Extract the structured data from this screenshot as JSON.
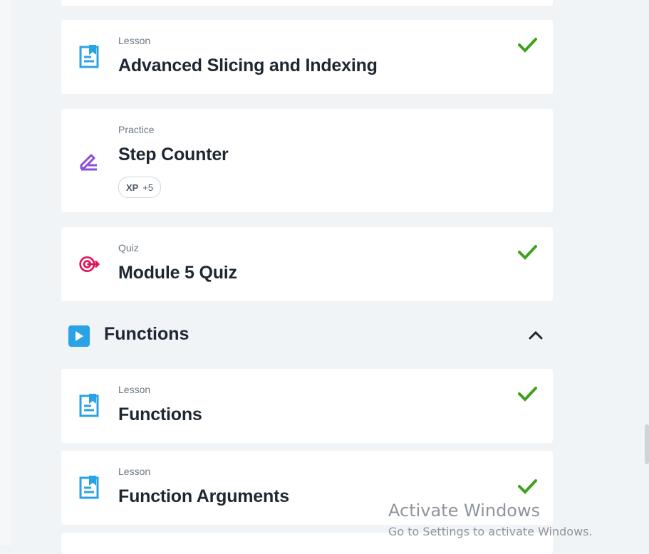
{
  "items": [
    {
      "kind": "Lesson",
      "title": "Advanced Slicing and Indexing",
      "completed": true,
      "icon": "lesson-doc-icon"
    },
    {
      "kind": "Practice",
      "title": "Step Counter",
      "completed": false,
      "icon": "pencil-practice-icon",
      "xp_label": "XP",
      "xp_value": "+5"
    },
    {
      "kind": "Quiz",
      "title": "Module 5 Quiz",
      "completed": true,
      "icon": "target-quiz-icon"
    },
    {
      "kind": "Lesson",
      "title": "Functions",
      "completed": true,
      "icon": "lesson-doc-icon"
    },
    {
      "kind": "Lesson",
      "title": "Function Arguments",
      "completed": true,
      "icon": "lesson-doc-icon"
    }
  ],
  "section": {
    "title": "Functions",
    "expanded": true
  },
  "watermark": {
    "title": "Activate Windows",
    "subtitle": "Go to Settings to activate Windows."
  },
  "colors": {
    "lesson_icon": "#2aa3e6",
    "practice_icon": "#8a4fd8",
    "quiz_icon": "#e2135a",
    "check": "#3fa11d",
    "background": "#f1f4f7"
  }
}
